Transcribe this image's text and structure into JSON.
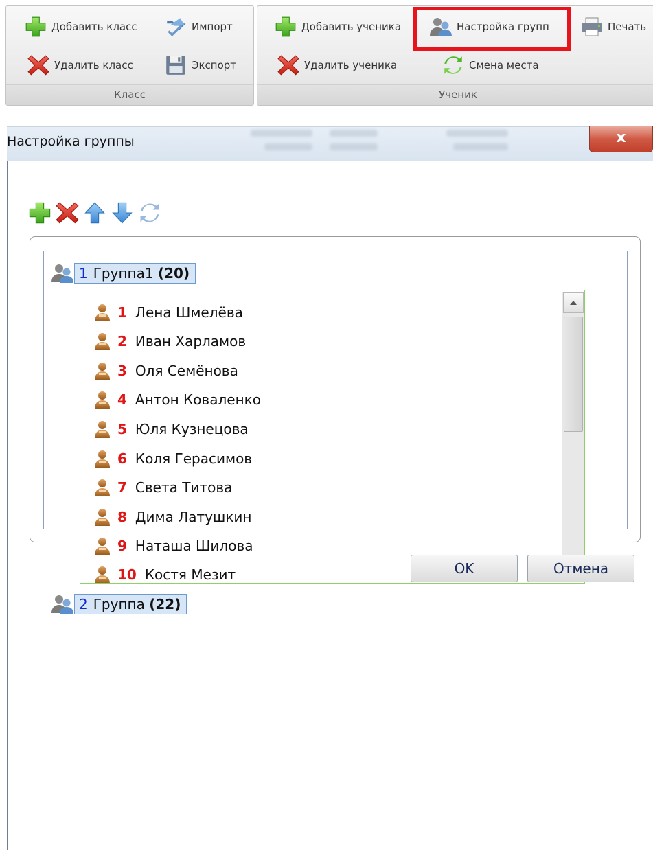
{
  "ribbon": {
    "class_group": {
      "caption": "Класс",
      "add_class": "Добавить класс",
      "import": "Импорт",
      "delete_class": "Удалить класс",
      "export": "Экспорт"
    },
    "student_group": {
      "caption": "Ученик",
      "add_student": "Добавить ученика",
      "group_settings": "Настройка групп",
      "print": "Печать",
      "delete_student": "Удалить ученика",
      "change_seat": "Смена места"
    }
  },
  "dialog": {
    "title": "Настройка группы",
    "close_glyph": "x",
    "ok_label": "OK",
    "cancel_label": "Отмена"
  },
  "groups": [
    {
      "number": "1",
      "name": "Группа1",
      "count": "(20)"
    },
    {
      "number": "2",
      "name": "Группа",
      "count": "(22)"
    }
  ],
  "students": [
    {
      "number": "1",
      "name": "Лена Шмелёва"
    },
    {
      "number": "2",
      "name": "Иван Харламов"
    },
    {
      "number": "3",
      "name": "Оля Семёнова"
    },
    {
      "number": "4",
      "name": "Антон Коваленко"
    },
    {
      "number": "5",
      "name": "Юля Кузнецова"
    },
    {
      "number": "6",
      "name": "Коля Герасимов"
    },
    {
      "number": "7",
      "name": "Света Титова"
    },
    {
      "number": "8",
      "name": "Дима Латушкин"
    },
    {
      "number": "9",
      "name": "Наташа Шилова"
    },
    {
      "number": "10",
      "name": "Костя Мезит"
    }
  ],
  "icons": {
    "add": "plus-icon",
    "delete": "cross-icon",
    "up": "arrow-up-icon",
    "down": "arrow-down-icon",
    "refresh": "refresh-icon",
    "group": "group-icon",
    "student": "student-icon"
  },
  "colors": {
    "highlight": "#e8141c",
    "student_number": "#e01616",
    "group_number": "#0b2ccf",
    "group_label_bg": "#d7e6f7"
  }
}
